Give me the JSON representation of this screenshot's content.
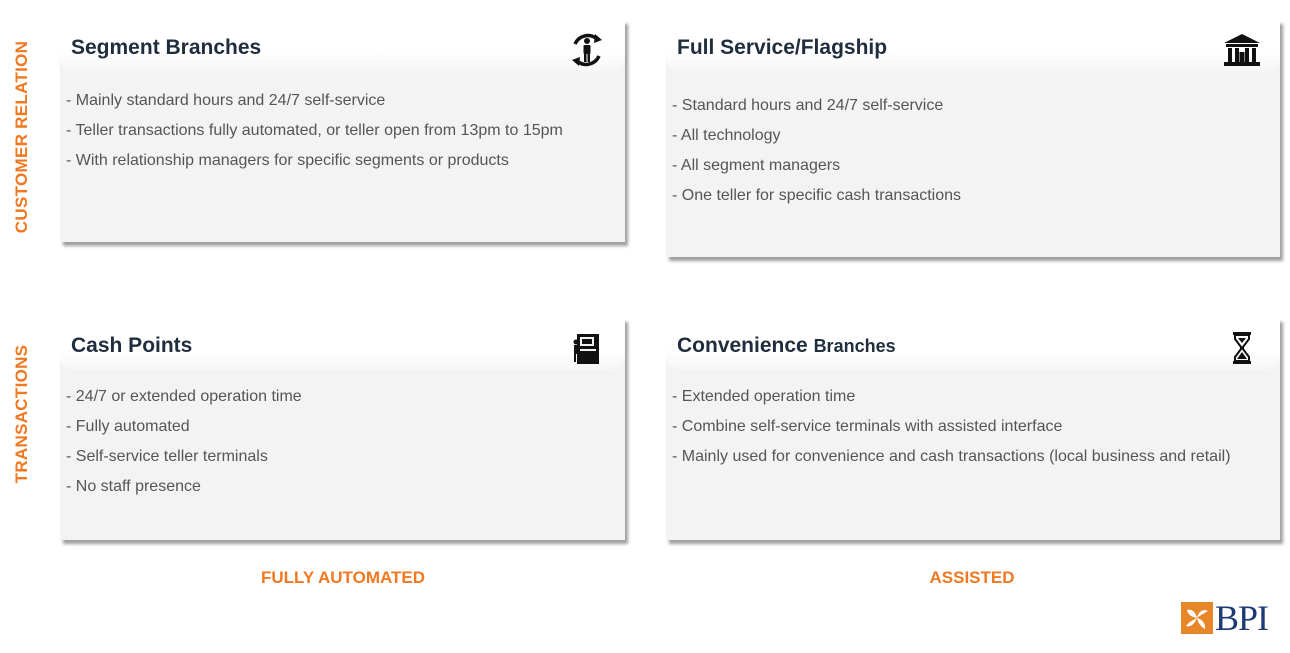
{
  "row_labels": {
    "top": "CUSTOMER RELATION",
    "bottom": "TRANSACTIONS"
  },
  "column_labels": {
    "left": "FULLY AUTOMATED",
    "right": "ASSISTED"
  },
  "cards": {
    "segment_branches": {
      "title": "Segment Branches",
      "icon": "person-cycle-icon",
      "items": [
        "- Mainly standard hours and 24/7 self-service",
        "- Teller transactions fully automated, or teller open from 13pm to 15pm",
        "- With relationship managers for specific segments or products"
      ]
    },
    "full_service": {
      "title": "Full Service/Flagship",
      "icon": "bank-building-icon",
      "items": [
        "- Standard hours and 24/7 self-service",
        "- All technology",
        "- All segment managers",
        "- One teller for specific cash transactions"
      ]
    },
    "cash_points": {
      "title": "Cash Points",
      "icon": "atm-icon",
      "items": [
        "- 24/7 or extended operation time",
        "- Fully automated",
        "- Self-service teller terminals",
        "- No staff presence"
      ]
    },
    "convenience": {
      "title": "Convenience",
      "title_suffix": "Branches",
      "icon": "hourglass-icon",
      "items": [
        "- Extended operation time",
        "- Combine self-service terminals with assisted interface",
        "- Mainly used for convenience and cash transactions (local business and retail)"
      ]
    }
  },
  "logo": {
    "text": "BPI"
  },
  "colors": {
    "accent": "#f07820",
    "title": "#1f2d3d",
    "body_text": "#555555",
    "card_bg": "#f3f3f3",
    "logo_blue": "#1d3a75",
    "logo_orange": "#e8862a"
  }
}
